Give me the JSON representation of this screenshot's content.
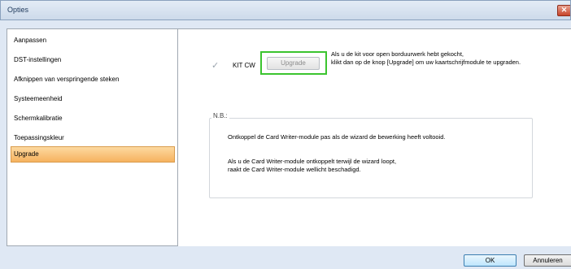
{
  "window": {
    "title": "Opties",
    "close_label": "✕"
  },
  "sidebar": {
    "items": [
      {
        "label": "Aanpassen",
        "active": false
      },
      {
        "label": "DST-instellingen",
        "active": false
      },
      {
        "label": "Afknippen van verspringende steken",
        "active": false
      },
      {
        "label": "Systeemeenheid",
        "active": false
      },
      {
        "label": "Schermkalibratie",
        "active": false
      },
      {
        "label": "Toepassingskleur",
        "active": false
      },
      {
        "label": "Upgrade",
        "active": true
      }
    ]
  },
  "upgrade": {
    "check_icon": "checkmark-icon",
    "check_glyph": "✓",
    "kit_label": "KIT CW",
    "upgrade_button": "Upgrade",
    "description_line1": "Als u de kit voor open borduurwerk hebt gekocht,",
    "description_line2": "klikt dan op de knop [Upgrade] om uw kaartschrijfmodule te upgraden.",
    "highlight_color": "#3bc42f"
  },
  "note": {
    "label": "N.B.:",
    "line1": "Ontkoppel de Card Writer-module pas als de wizard de bewerking heeft voltooid.",
    "line2a": "Als u de Card Writer-module ontkoppelt terwijl de wizard loopt,",
    "line2b": "raakt de Card Writer-module wellicht beschadigd."
  },
  "footer": {
    "ok_label": "OK",
    "cancel_label": "Annuleren"
  },
  "colors": {
    "active_item": "#f6b25f",
    "frame": "#dfe8f4"
  }
}
